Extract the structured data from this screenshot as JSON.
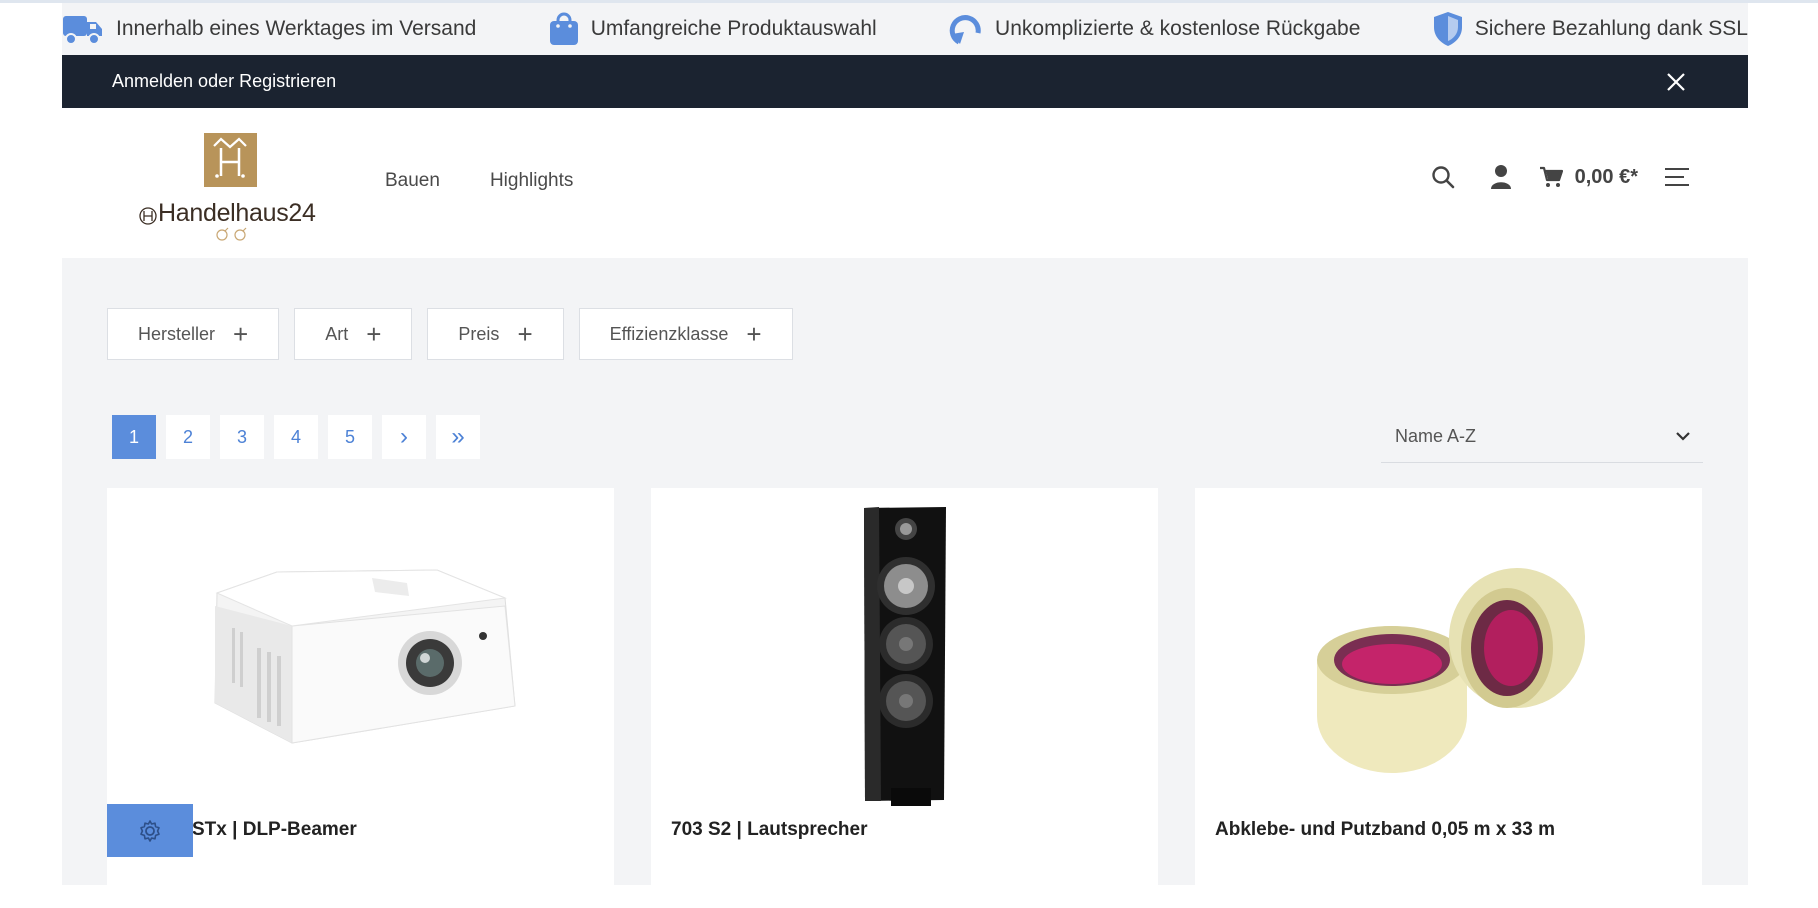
{
  "usp_bar": {
    "items": [
      {
        "icon": "truck-icon",
        "label": "Innerhalb eines Werktages im Versand"
      },
      {
        "icon": "shopping-bag-icon",
        "label": "Umfangreiche Produktauswahl"
      },
      {
        "icon": "return-arrow-icon",
        "label": "Unkomplizierte & kostenlose Rückgabe"
      },
      {
        "icon": "shield-icon",
        "label": "Sichere Bezahlung dank SSL"
      }
    ]
  },
  "login_bar": {
    "label": "Anmelden oder Registrieren"
  },
  "header": {
    "logo_text": "Handelhaus24",
    "nav": [
      {
        "label": "Bauen"
      },
      {
        "label": "Highlights"
      }
    ],
    "cart_total": "0,00 €*"
  },
  "filters": [
    {
      "label": "Hersteller"
    },
    {
      "label": "Art"
    },
    {
      "label": "Preis"
    },
    {
      "label": "Effizienzklasse"
    }
  ],
  "pagination": {
    "pages": [
      "1",
      "2",
      "3",
      "4",
      "5"
    ],
    "current": "1",
    "next": "›",
    "last": "»"
  },
  "sort": {
    "selected": "Name A-Z"
  },
  "products": [
    {
      "title": "STx | DLP-Beamer",
      "image": "projector"
    },
    {
      "title": "703 S2 | Lautsprecher",
      "image": "floor-speaker"
    },
    {
      "title": "Abklebe- und Putzband 0,05 m x 33 m",
      "image": "tape-rolls"
    }
  ],
  "colors": {
    "accent": "#5b8ddc",
    "dark_bar": "#1b2330",
    "background": "#f3f4f6"
  }
}
